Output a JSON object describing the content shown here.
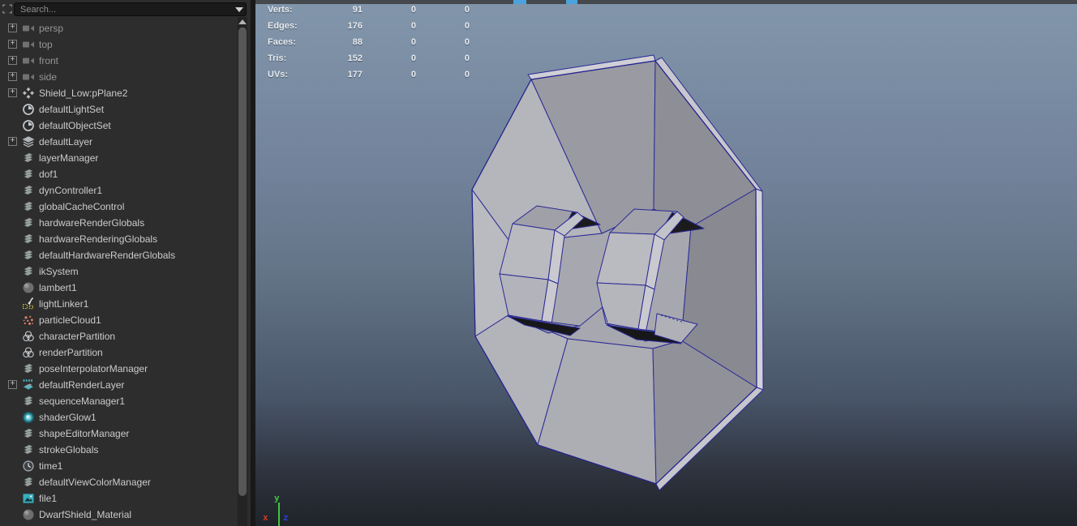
{
  "outliner": {
    "search": {
      "placeholder": "Search..."
    },
    "items": [
      {
        "label": "persp",
        "icon": "camera-icon",
        "expandable": true,
        "dim": true
      },
      {
        "label": "top",
        "icon": "camera-icon",
        "expandable": true,
        "dim": true
      },
      {
        "label": "front",
        "icon": "camera-icon",
        "expandable": true,
        "dim": true
      },
      {
        "label": "side",
        "icon": "camera-icon",
        "expandable": true,
        "dim": true
      },
      {
        "label": "Shield_Low:pPlane2",
        "icon": "transform-icon",
        "expandable": true,
        "dim": false
      },
      {
        "label": "defaultLightSet",
        "icon": "set-icon",
        "expandable": false,
        "dim": false
      },
      {
        "label": "defaultObjectSet",
        "icon": "set-icon",
        "expandable": false,
        "dim": false
      },
      {
        "label": "defaultLayer",
        "icon": "layer-icon",
        "expandable": true,
        "dim": false
      },
      {
        "label": "layerManager",
        "icon": "manager-icon",
        "expandable": false,
        "dim": false
      },
      {
        "label": "dof1",
        "icon": "manager-icon",
        "expandable": false,
        "dim": false
      },
      {
        "label": "dynController1",
        "icon": "manager-icon",
        "expandable": false,
        "dim": false
      },
      {
        "label": "globalCacheControl",
        "icon": "manager-icon",
        "expandable": false,
        "dim": false
      },
      {
        "label": "hardwareRenderGlobals",
        "icon": "manager-icon",
        "expandable": false,
        "dim": false
      },
      {
        "label": "hardwareRenderingGlobals",
        "icon": "manager-icon",
        "expandable": false,
        "dim": false
      },
      {
        "label": "defaultHardwareRenderGlobals",
        "icon": "manager-icon",
        "expandable": false,
        "dim": false
      },
      {
        "label": "ikSystem",
        "icon": "manager-icon",
        "expandable": false,
        "dim": false
      },
      {
        "label": "lambert1",
        "icon": "material-sphere-icon",
        "expandable": false,
        "dim": false
      },
      {
        "label": "lightLinker1",
        "icon": "light-linker-icon",
        "expandable": false,
        "dim": false
      },
      {
        "label": "particleCloud1",
        "icon": "particle-cloud-icon",
        "expandable": false,
        "dim": false
      },
      {
        "label": "characterPartition",
        "icon": "partition-icon",
        "expandable": false,
        "dim": false
      },
      {
        "label": "renderPartition",
        "icon": "partition-icon",
        "expandable": false,
        "dim": false
      },
      {
        "label": "poseInterpolatorManager",
        "icon": "manager-icon",
        "expandable": false,
        "dim": false
      },
      {
        "label": "defaultRenderLayer",
        "icon": "render-layer-icon",
        "expandable": true,
        "dim": false
      },
      {
        "label": "sequenceManager1",
        "icon": "manager-icon",
        "expandable": false,
        "dim": false
      },
      {
        "label": "shaderGlow1",
        "icon": "shader-glow-icon",
        "expandable": false,
        "dim": false
      },
      {
        "label": "shapeEditorManager",
        "icon": "manager-icon",
        "expandable": false,
        "dim": false
      },
      {
        "label": "strokeGlobals",
        "icon": "manager-icon",
        "expandable": false,
        "dim": false
      },
      {
        "label": "time1",
        "icon": "clock-icon",
        "expandable": false,
        "dim": false
      },
      {
        "label": "defaultViewColorManager",
        "icon": "manager-icon",
        "expandable": false,
        "dim": false
      },
      {
        "label": "file1",
        "icon": "file-icon",
        "expandable": false,
        "dim": false
      },
      {
        "label": "DwarfShield_Material",
        "icon": "material-sphere-icon",
        "expandable": false,
        "dim": false
      }
    ]
  },
  "viewport": {
    "stats": {
      "rows": [
        {
          "label": "Verts:",
          "values": [
            "91",
            "0",
            "0"
          ]
        },
        {
          "label": "Edges:",
          "values": [
            "176",
            "0",
            "0"
          ]
        },
        {
          "label": "Faces:",
          "values": [
            "88",
            "0",
            "0"
          ]
        },
        {
          "label": "Tris:",
          "values": [
            "152",
            "0",
            "0"
          ]
        },
        {
          "label": "UVs:",
          "values": [
            "177",
            "0",
            "0"
          ]
        }
      ]
    },
    "axis": {
      "x": "x",
      "y": "y",
      "z": "z"
    },
    "colors": {
      "wireframe": "#2a2a96",
      "background_top": "#8296ab",
      "background_bottom": "#1f242a",
      "toolbar_chip": "#4aa3dc"
    }
  }
}
